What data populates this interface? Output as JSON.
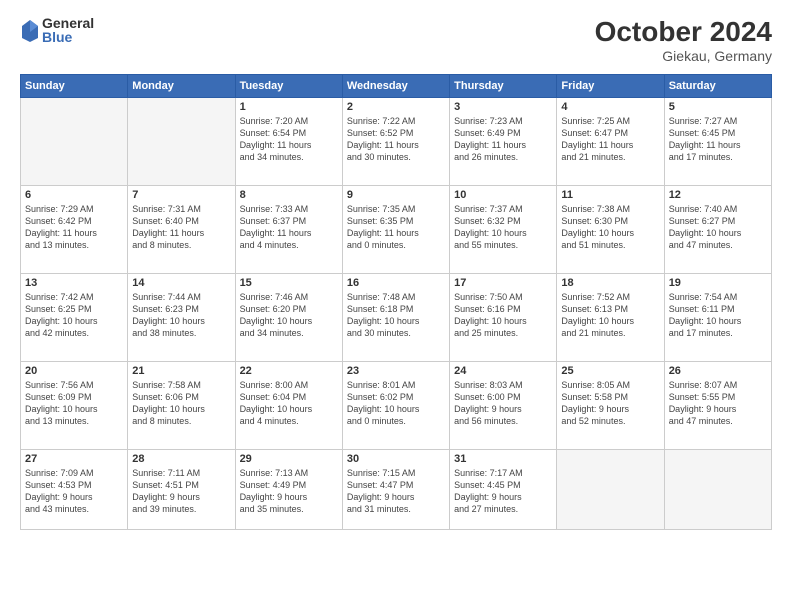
{
  "header": {
    "logo_general": "General",
    "logo_blue": "Blue",
    "month_title": "October 2024",
    "location": "Giekau, Germany"
  },
  "weekdays": [
    "Sunday",
    "Monday",
    "Tuesday",
    "Wednesday",
    "Thursday",
    "Friday",
    "Saturday"
  ],
  "weeks": [
    [
      {
        "day": "",
        "content": ""
      },
      {
        "day": "",
        "content": ""
      },
      {
        "day": "1",
        "content": "Sunrise: 7:20 AM\nSunset: 6:54 PM\nDaylight: 11 hours\nand 34 minutes."
      },
      {
        "day": "2",
        "content": "Sunrise: 7:22 AM\nSunset: 6:52 PM\nDaylight: 11 hours\nand 30 minutes."
      },
      {
        "day": "3",
        "content": "Sunrise: 7:23 AM\nSunset: 6:49 PM\nDaylight: 11 hours\nand 26 minutes."
      },
      {
        "day": "4",
        "content": "Sunrise: 7:25 AM\nSunset: 6:47 PM\nDaylight: 11 hours\nand 21 minutes."
      },
      {
        "day": "5",
        "content": "Sunrise: 7:27 AM\nSunset: 6:45 PM\nDaylight: 11 hours\nand 17 minutes."
      }
    ],
    [
      {
        "day": "6",
        "content": "Sunrise: 7:29 AM\nSunset: 6:42 PM\nDaylight: 11 hours\nand 13 minutes."
      },
      {
        "day": "7",
        "content": "Sunrise: 7:31 AM\nSunset: 6:40 PM\nDaylight: 11 hours\nand 8 minutes."
      },
      {
        "day": "8",
        "content": "Sunrise: 7:33 AM\nSunset: 6:37 PM\nDaylight: 11 hours\nand 4 minutes."
      },
      {
        "day": "9",
        "content": "Sunrise: 7:35 AM\nSunset: 6:35 PM\nDaylight: 11 hours\nand 0 minutes."
      },
      {
        "day": "10",
        "content": "Sunrise: 7:37 AM\nSunset: 6:32 PM\nDaylight: 10 hours\nand 55 minutes."
      },
      {
        "day": "11",
        "content": "Sunrise: 7:38 AM\nSunset: 6:30 PM\nDaylight: 10 hours\nand 51 minutes."
      },
      {
        "day": "12",
        "content": "Sunrise: 7:40 AM\nSunset: 6:27 PM\nDaylight: 10 hours\nand 47 minutes."
      }
    ],
    [
      {
        "day": "13",
        "content": "Sunrise: 7:42 AM\nSunset: 6:25 PM\nDaylight: 10 hours\nand 42 minutes."
      },
      {
        "day": "14",
        "content": "Sunrise: 7:44 AM\nSunset: 6:23 PM\nDaylight: 10 hours\nand 38 minutes."
      },
      {
        "day": "15",
        "content": "Sunrise: 7:46 AM\nSunset: 6:20 PM\nDaylight: 10 hours\nand 34 minutes."
      },
      {
        "day": "16",
        "content": "Sunrise: 7:48 AM\nSunset: 6:18 PM\nDaylight: 10 hours\nand 30 minutes."
      },
      {
        "day": "17",
        "content": "Sunrise: 7:50 AM\nSunset: 6:16 PM\nDaylight: 10 hours\nand 25 minutes."
      },
      {
        "day": "18",
        "content": "Sunrise: 7:52 AM\nSunset: 6:13 PM\nDaylight: 10 hours\nand 21 minutes."
      },
      {
        "day": "19",
        "content": "Sunrise: 7:54 AM\nSunset: 6:11 PM\nDaylight: 10 hours\nand 17 minutes."
      }
    ],
    [
      {
        "day": "20",
        "content": "Sunrise: 7:56 AM\nSunset: 6:09 PM\nDaylight: 10 hours\nand 13 minutes."
      },
      {
        "day": "21",
        "content": "Sunrise: 7:58 AM\nSunset: 6:06 PM\nDaylight: 10 hours\nand 8 minutes."
      },
      {
        "day": "22",
        "content": "Sunrise: 8:00 AM\nSunset: 6:04 PM\nDaylight: 10 hours\nand 4 minutes."
      },
      {
        "day": "23",
        "content": "Sunrise: 8:01 AM\nSunset: 6:02 PM\nDaylight: 10 hours\nand 0 minutes."
      },
      {
        "day": "24",
        "content": "Sunrise: 8:03 AM\nSunset: 6:00 PM\nDaylight: 9 hours\nand 56 minutes."
      },
      {
        "day": "25",
        "content": "Sunrise: 8:05 AM\nSunset: 5:58 PM\nDaylight: 9 hours\nand 52 minutes."
      },
      {
        "day": "26",
        "content": "Sunrise: 8:07 AM\nSunset: 5:55 PM\nDaylight: 9 hours\nand 47 minutes."
      }
    ],
    [
      {
        "day": "27",
        "content": "Sunrise: 7:09 AM\nSunset: 4:53 PM\nDaylight: 9 hours\nand 43 minutes."
      },
      {
        "day": "28",
        "content": "Sunrise: 7:11 AM\nSunset: 4:51 PM\nDaylight: 9 hours\nand 39 minutes."
      },
      {
        "day": "29",
        "content": "Sunrise: 7:13 AM\nSunset: 4:49 PM\nDaylight: 9 hours\nand 35 minutes."
      },
      {
        "day": "30",
        "content": "Sunrise: 7:15 AM\nSunset: 4:47 PM\nDaylight: 9 hours\nand 31 minutes."
      },
      {
        "day": "31",
        "content": "Sunrise: 7:17 AM\nSunset: 4:45 PM\nDaylight: 9 hours\nand 27 minutes."
      },
      {
        "day": "",
        "content": ""
      },
      {
        "day": "",
        "content": ""
      }
    ]
  ]
}
